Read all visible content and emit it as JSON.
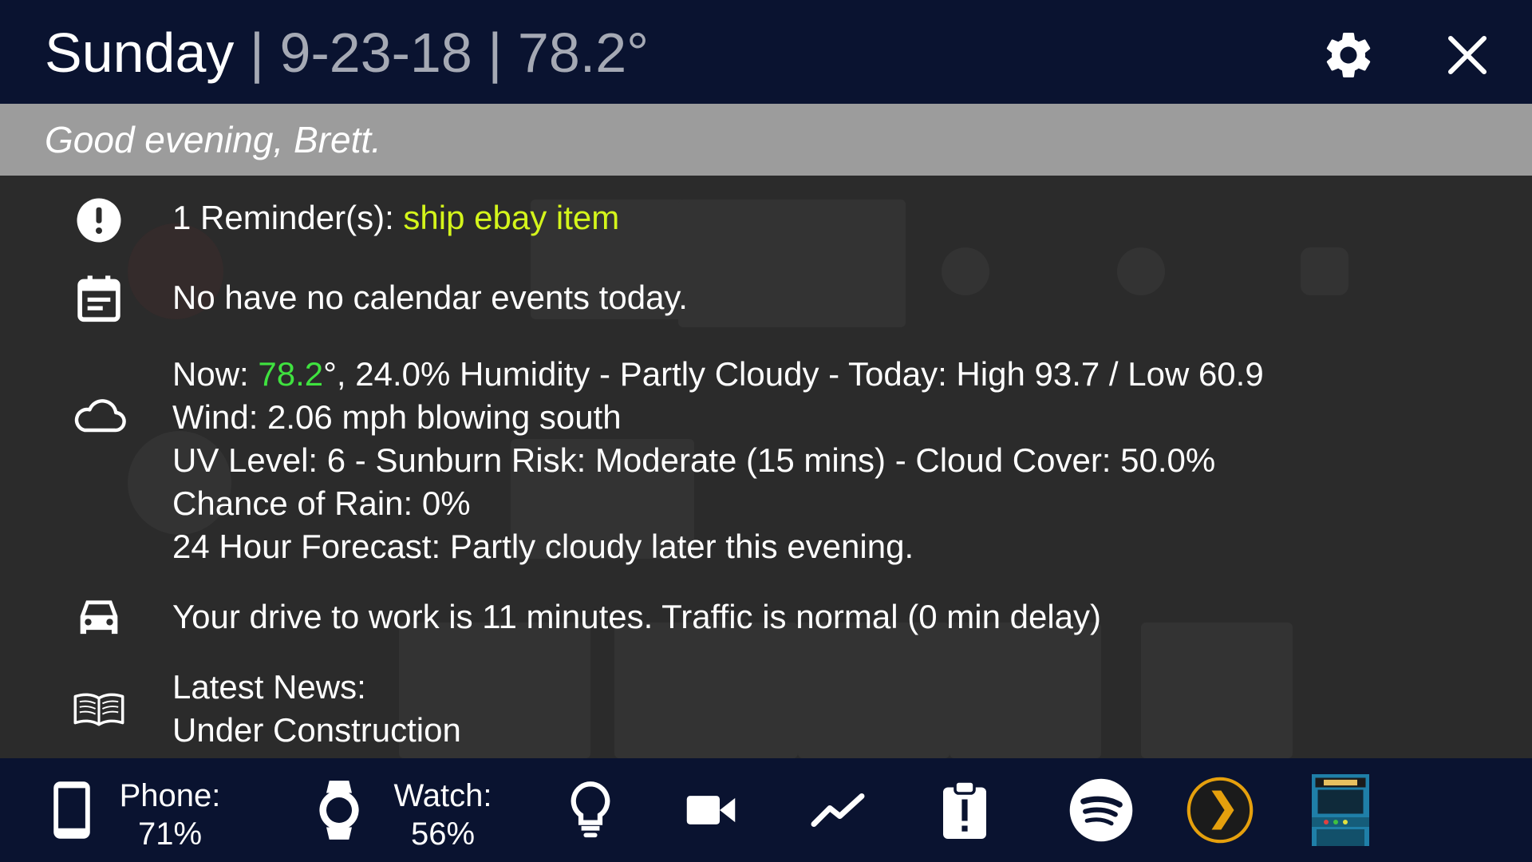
{
  "header": {
    "day": "Sunday",
    "separator": "|",
    "date": "9-23-18",
    "temperature": "78.2°"
  },
  "greeting": "Good evening, Brett.",
  "reminder": {
    "prefix": "1 Reminder(s): ",
    "item": "ship ebay item",
    "icon": "alert-circle-icon"
  },
  "calendar": {
    "text": "No have no calendar events today.",
    "icon": "calendar-icon"
  },
  "weather": {
    "icon": "cloud-icon",
    "now_label": "Now: ",
    "now_temp": "78.2",
    "now_rest": "°, 24.0% Humidity - Partly Cloudy - Today: High 93.7 / Low 60.9",
    "wind": "Wind: 2.06 mph blowing south",
    "uv": "UV Level: 6 - Sunburn Risk: Moderate (15 mins) - Cloud Cover: 50.0%",
    "rain": "Chance of Rain: 0%",
    "forecast": "24 Hour Forecast: Partly cloudy later this evening."
  },
  "traffic": {
    "text": "Your drive to work is 11 minutes. Traffic is normal (0 min delay)",
    "icon": "car-icon"
  },
  "news": {
    "title": "Latest News:",
    "body": "Under Construction",
    "icon": "book-icon"
  },
  "footer": {
    "phone_label": "Phone:",
    "phone_value": "71%",
    "watch_label": "Watch:",
    "watch_value": "56%",
    "icons": [
      "phone-icon",
      "watch-icon",
      "lightbulb-icon",
      "video-camera-icon",
      "trend-icon",
      "clipboard-alert-icon",
      "spotify-icon",
      "plex-icon",
      "arcade-browser-icon"
    ]
  },
  "colors": {
    "header_bg": "#0a1330",
    "greeting_bg": "#9c9c9c",
    "body_bg": "#2b2b2b",
    "reminder_highlight": "#d4f51b",
    "temp_highlight": "#3fe23f",
    "spotify": "#ffffff",
    "plex": "#e5a00d"
  }
}
